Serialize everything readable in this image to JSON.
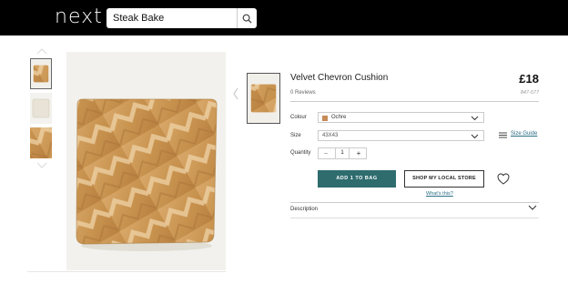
{
  "header": {
    "logo_text": "next",
    "search_value": "Steak Bake",
    "search_icon": "search-icon"
  },
  "gallery": {
    "thumbnails": [
      {
        "name": "ochre-cushion",
        "selected": true
      },
      {
        "name": "white-cushion",
        "selected": false
      },
      {
        "name": "ochre-cushion-closeup",
        "selected": false
      }
    ]
  },
  "product": {
    "title": "Velvet Chevron Cushion",
    "price": "£18",
    "reviews": "0 Reviews",
    "sku": "847-577",
    "colour_label": "Colour",
    "colour_value": "Ochre",
    "colour_swatch": "#c68b58",
    "size_label": "Size",
    "size_value": "43X43",
    "size_guide": "Size Guide",
    "quantity_label": "Quantity",
    "quantity": "1",
    "minus": "−",
    "plus": "+",
    "add_to_bag": "ADD 1 TO BAG",
    "shop_local": "SHOP MY LOCAL STORE",
    "whats_this": "What's this?",
    "description_label": "Description"
  },
  "colors": {
    "header_bg": "#000000",
    "accent": "#2e6c6e",
    "link": "#2c6f86",
    "ochre": "#c68b58"
  }
}
